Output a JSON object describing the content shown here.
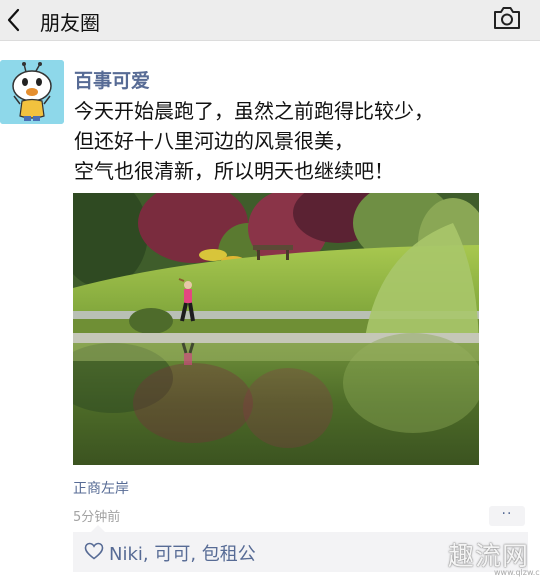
{
  "header": {
    "title": "朋友圈"
  },
  "post": {
    "author": "百事可爱",
    "text_lines": [
      "今天开始晨跑了，虽然之前跑得比较少，",
      "但还好十八里河边的风景很美，",
      "空气也很清新，所以明天也继续吧！"
    ],
    "location": "正商左岸",
    "time": "5分钟前",
    "more_label": "··",
    "likes": "Niki, 可可, 包租公"
  },
  "watermark": {
    "title": "趣流网",
    "url": "www.qlzw.com"
  },
  "icons": {
    "back": "chevron-left-icon",
    "camera": "camera-icon",
    "heart": "heart-icon",
    "avatar": "cartoon-avatar"
  },
  "colors": {
    "link": "#576b95",
    "header_bg": "#ededed",
    "likes_bg": "#f3f3f5"
  }
}
